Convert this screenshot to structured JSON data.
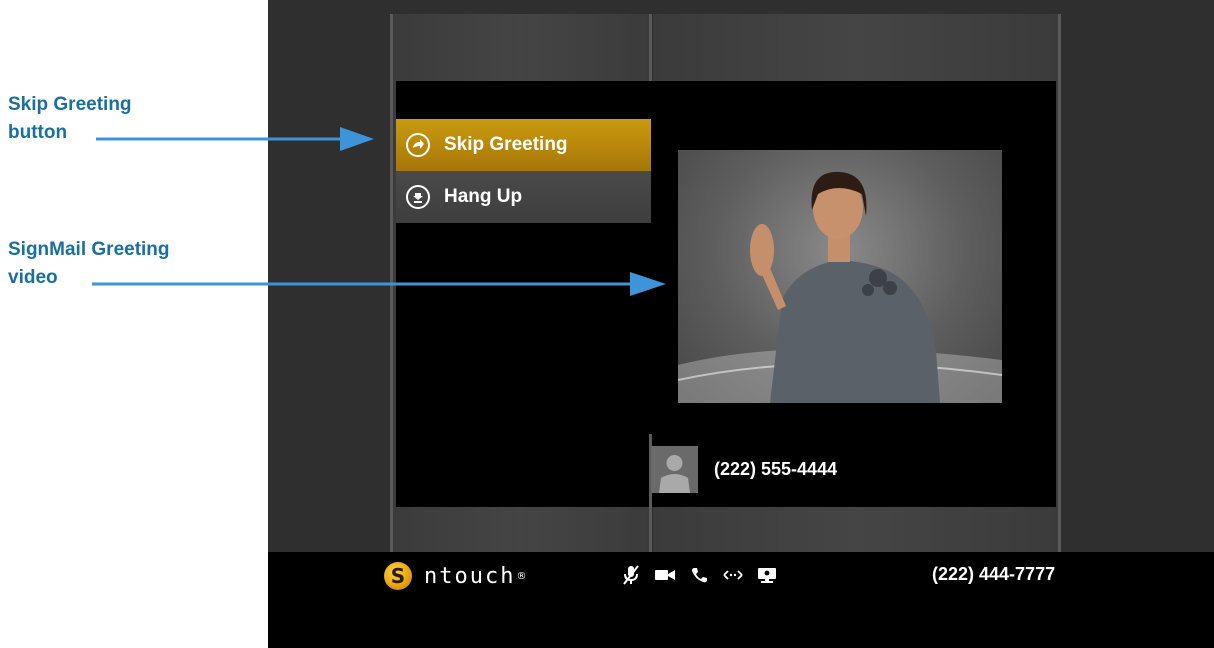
{
  "callouts": {
    "skip": {
      "line1": "Skip Greeting",
      "line2": "button"
    },
    "video": {
      "line1": "SignMail Greeting",
      "line2": "video"
    }
  },
  "menu": {
    "items": [
      {
        "label": "Skip Greeting",
        "icon": "forward-arrow-icon",
        "state": "active"
      },
      {
        "label": "Hang Up",
        "icon": "hang-up-icon",
        "state": "normal"
      }
    ]
  },
  "contact": {
    "number": "(222) 555-4444",
    "icon": "person-silhouette-icon"
  },
  "bottom_bar": {
    "brand_name": "ntouch",
    "brand_reg": "®",
    "brand_logo_letter": "S",
    "tools": [
      "mic-muted-icon",
      "video-camera-icon",
      "phone-icon",
      "share-arrows-icon",
      "screen-share-icon"
    ],
    "my_number": "(222) 444-7777"
  },
  "colors": {
    "callout_text": "#1a6fa0",
    "arrow": "#3f93d8",
    "accent_gold": "#b8860b"
  }
}
